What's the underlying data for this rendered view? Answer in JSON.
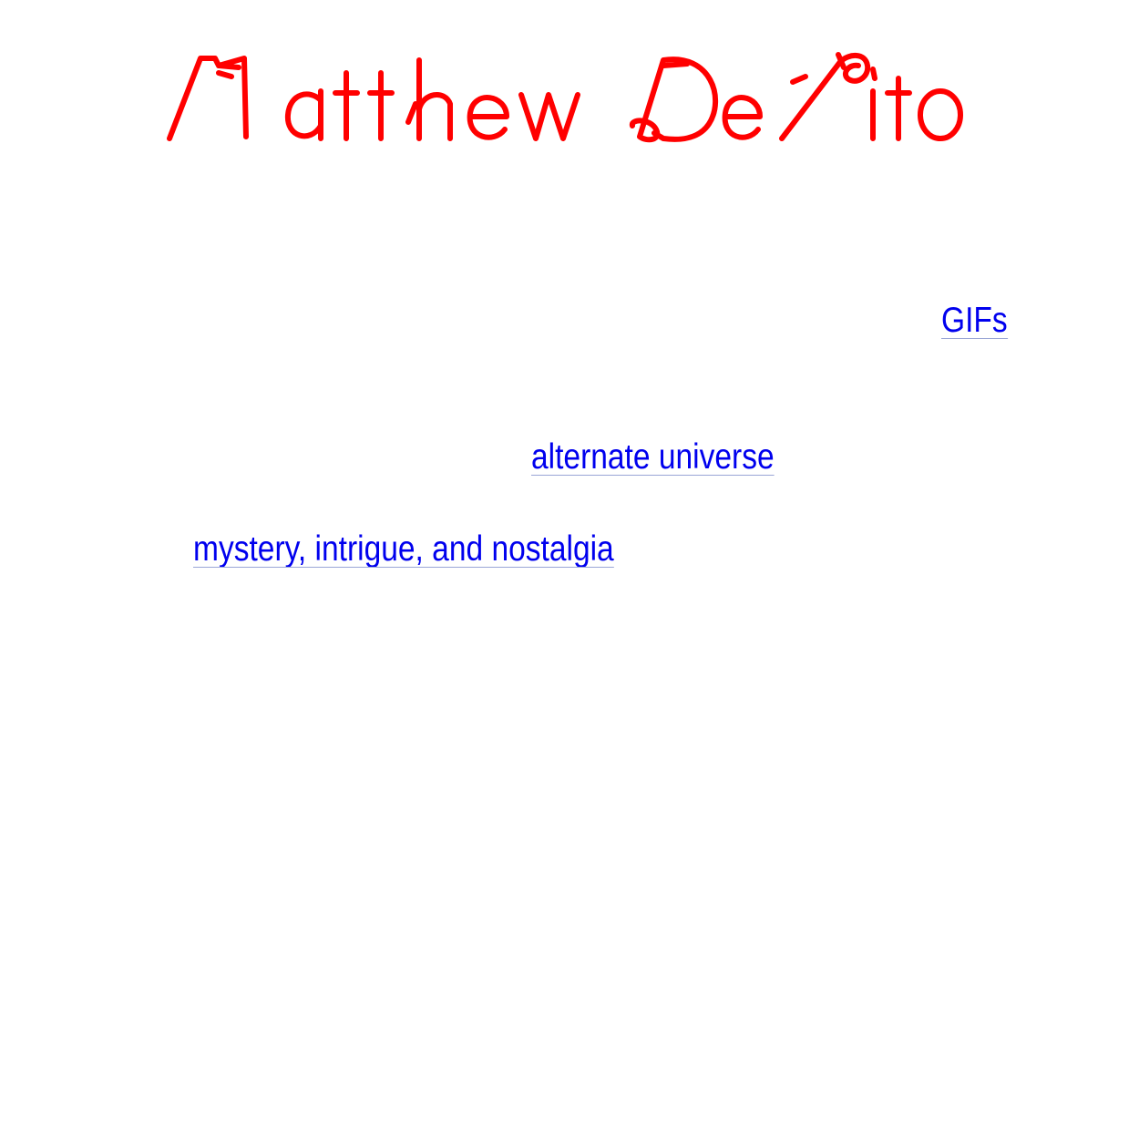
{
  "header": {
    "logo_text": "Matthew DeVito",
    "logo_color": "#ff0000"
  },
  "links": {
    "gifs": "GIFs",
    "alternate_universe": "alternate universe",
    "mystery": "mystery, intrigue, and nostalgia"
  },
  "colors": {
    "link": "#0000ee",
    "background": "#ffffff"
  }
}
